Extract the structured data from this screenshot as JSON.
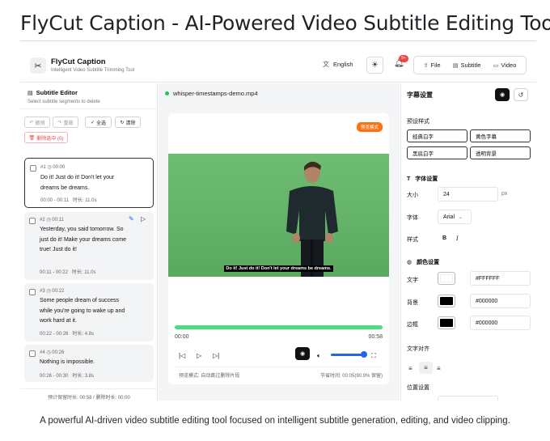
{
  "page": {
    "title": "FlyCut Caption - AI-Powered Video Subtitle Editing Tool",
    "caption": "A powerful AI-driven video subtitle editing tool focused on intelligent subtitle generation, editing, and video clipping."
  },
  "header": {
    "logo_icon": "scissors-icon",
    "app_name": "FlyCut Caption",
    "app_subtitle": "Intelligent Video Subtitle Trimming Tool",
    "language": "English",
    "notification_badge": "9+",
    "nav": [
      {
        "label": "File",
        "icon": "upload-icon"
      },
      {
        "label": "Subtitle",
        "icon": "document-icon"
      },
      {
        "label": "Video",
        "icon": "video-icon"
      }
    ]
  },
  "editor": {
    "title": "Subtitle Editor",
    "subtitle": "Select subtitle segments to delete",
    "undo": "撤销",
    "redo": "重做",
    "select_all": "全选",
    "clear": "清除",
    "delete_selected": "删除选中 (0)",
    "subtitles": [
      {
        "index": "#1",
        "start": "00:00",
        "text": "Do it! Just do it! Don't let your dreams be dreams.",
        "range": "00:00 - 00:11",
        "duration": "时长: 11.0s"
      },
      {
        "index": "#2",
        "start": "00:11",
        "text": "Yesterday, you said tomorrow. So just do it! Make your dreams come true! Just do it!",
        "range": "00:11 - 00:22",
        "duration": "时长: 11.0s"
      },
      {
        "index": "#3",
        "start": "00:22",
        "text": "Some people dream of success while you're going to wake up and work hard at it.",
        "range": "00:22 - 00:26",
        "duration": "时长: 4.8s"
      },
      {
        "index": "#4",
        "start": "00:26",
        "text": "Nothing is impossible.",
        "range": "00:26 - 00:30",
        "duration": "时长: 3.8s"
      }
    ],
    "footer": "预计保留时长: 00:58 / 删除时长: 00:00"
  },
  "player": {
    "filename": "whisper-timestamps-demo.mp4",
    "badge": "预览模式",
    "caption": "Do it! Just do it! Don't let your dreams be dreams.",
    "current_time": "00:00",
    "total_time": "00:58",
    "progress": 1.0,
    "volume": 0.85,
    "footer_left": "预览模式: 自动跳过删除片段",
    "footer_right": "节省时间: 00:05(90.9% 保留)"
  },
  "settings": {
    "title": "字幕设置",
    "presets_label": "预设样式",
    "presets": [
      "经典白字",
      "黄色字幕",
      "黑底白字",
      "透明背景"
    ],
    "font_section": "字体设置",
    "size_label": "大小",
    "size_value": "24",
    "size_unit": "px",
    "font_label": "字体",
    "font_value": "Arial",
    "style_label": "样式",
    "bold": "B",
    "italic": "I",
    "color_section": "颜色设置",
    "text_label": "文字",
    "text_color": "#FFFFFF",
    "bg_label": "背景",
    "bg_color": "#000000",
    "border_label": "边框",
    "border_color": "#000000",
    "align_label": "文字对齐",
    "position_label": "位置设置"
  },
  "colors": {
    "accent_green": "#4ade80",
    "accent_blue": "#2563eb",
    "badge_orange": "#f97316",
    "danger": "#ef4444"
  }
}
